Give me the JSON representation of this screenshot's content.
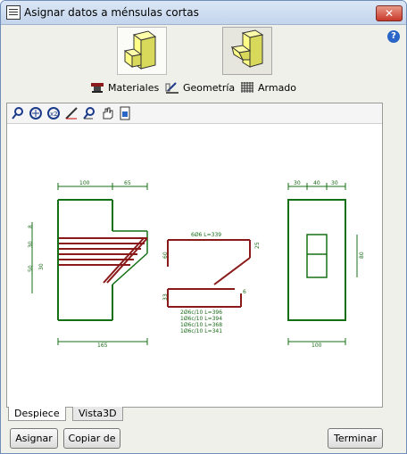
{
  "window": {
    "title": "Asignar datos a ménsulas cortas"
  },
  "top_tabs": {
    "materials": "Materiales",
    "geometry": "Geometría",
    "reinforcement": "Armado"
  },
  "bottom_tabs": {
    "despiece": "Despiece",
    "vista3d": "Vista3D"
  },
  "buttons": {
    "assign": "Asignar",
    "copy_from": "Copiar de",
    "finish": "Terminar"
  },
  "drawing": {
    "dims": {
      "d100_top": "100",
      "d65": "65",
      "d165": "165",
      "d30_left": "30",
      "d40": "40",
      "d30_right": "30",
      "d100_right": "100",
      "d80_right": "80",
      "d8": "8",
      "d30_vert": "30",
      "d50": "50",
      "d30_vert2": "30",
      "d60": "60",
      "d33": "33",
      "d25": "25",
      "d6": "6"
    },
    "bar_title": "6Ø6 L=339",
    "bar_lines": [
      "2Ø6c/10 L=396",
      "1Ø6c/10 L=394",
      "1Ø6c/10 L=368",
      "1Ø6c/10 L=341"
    ]
  }
}
